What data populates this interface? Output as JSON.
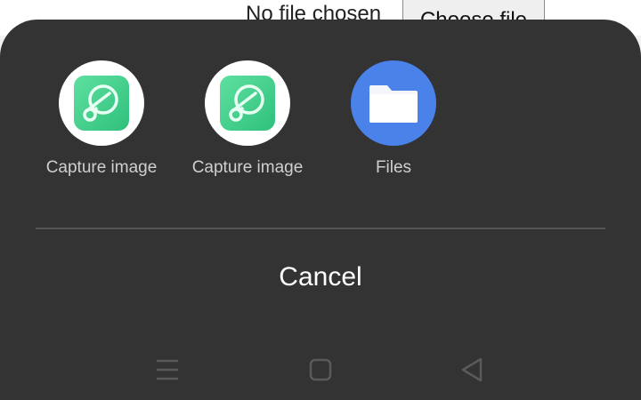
{
  "background_page": {
    "file_status": "No file chosen",
    "choose_file_label": "Choose file"
  },
  "chooser": {
    "apps": [
      {
        "label": "Capture image",
        "icon": "capture-app-icon"
      },
      {
        "label": "Capture image",
        "icon": "capture-app-icon"
      },
      {
        "label": "Files",
        "icon": "folder-icon"
      }
    ],
    "cancel_label": "Cancel"
  },
  "navbar": {
    "buttons": [
      {
        "name": "recents-button",
        "icon": "menu-lines-icon"
      },
      {
        "name": "home-button",
        "icon": "square-icon"
      },
      {
        "name": "back-button",
        "icon": "triangle-back-icon"
      }
    ]
  },
  "colors": {
    "sheet_bg": "#333333",
    "capture_green": "#3fd48a",
    "files_blue": "#4a82ea",
    "label_text": "#cfcfcf"
  }
}
